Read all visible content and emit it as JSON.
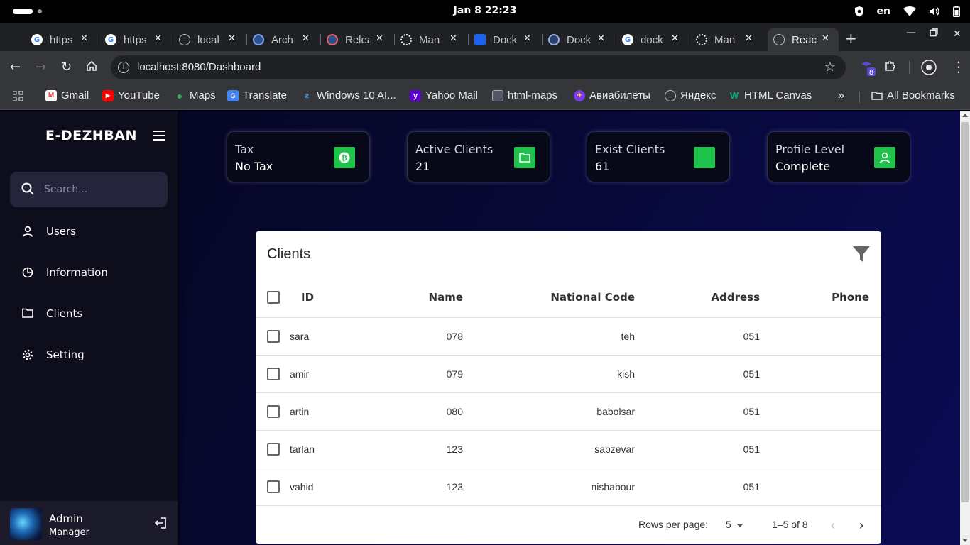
{
  "system": {
    "clock": "Jan 8  22:23",
    "language": "en"
  },
  "browser": {
    "tabs": [
      {
        "title": "https",
        "favicon": "google-icon",
        "active": false
      },
      {
        "title": "https",
        "favicon": "google-icon",
        "active": false
      },
      {
        "title": "local",
        "favicon": "globe-icon",
        "active": false
      },
      {
        "title": "Arch",
        "favicon": "docs-icon",
        "active": false
      },
      {
        "title": "Relea",
        "favicon": "docs-icon",
        "active": false
      },
      {
        "title": "Man",
        "favicon": "openai-icon",
        "active": false
      },
      {
        "title": "Dock",
        "favicon": "docker-icon",
        "active": false
      },
      {
        "title": "Dock",
        "favicon": "docs-icon",
        "active": false
      },
      {
        "title": "dock",
        "favicon": "google-icon",
        "active": false
      },
      {
        "title": "Man",
        "favicon": "openai-icon",
        "active": false
      },
      {
        "title": "Reac",
        "favicon": "globe-icon",
        "active": true
      }
    ],
    "url": "localhost:8080/Dashboard",
    "extension_badge": "8",
    "bookmarks": [
      {
        "label": "Gmail",
        "icon": "gmail-icon"
      },
      {
        "label": "YouTube",
        "icon": "youtube-icon"
      },
      {
        "label": "Maps",
        "icon": "maps-icon"
      },
      {
        "label": "Translate",
        "icon": "translate-icon"
      },
      {
        "label": "Windows 10 AI...",
        "icon": "windows-icon"
      },
      {
        "label": "Yahoo Mail",
        "icon": "yahoo-icon"
      },
      {
        "label": "html-maps",
        "icon": "image-icon"
      },
      {
        "label": "Авиабилеты",
        "icon": "plane-icon"
      },
      {
        "label": "Яндекс",
        "icon": "globe-icon"
      },
      {
        "label": "HTML Canvas",
        "icon": "w3-icon"
      }
    ],
    "all_bookmarks": "All Bookmarks"
  },
  "app": {
    "brand": "E-DEZHBAN",
    "search_placeholder": "Search...",
    "nav": [
      {
        "label": "Users",
        "icon": "user-icon"
      },
      {
        "label": "Information",
        "icon": "chart-icon"
      },
      {
        "label": "Clients",
        "icon": "folder-icon"
      },
      {
        "label": "Setting",
        "icon": "gear-icon"
      }
    ],
    "profile": {
      "name": "Admin",
      "role": "Manager"
    },
    "cards": [
      {
        "title": "Tax",
        "value": "No Tax",
        "icon": "bitcoin-icon"
      },
      {
        "title": "Active Clients",
        "value": "21",
        "icon": "folder-icon"
      },
      {
        "title": "Exist Clients",
        "value": "61",
        "icon": "blank-icon"
      },
      {
        "title": "Profile Level",
        "value": "Complete",
        "icon": "user-icon"
      }
    ],
    "accent": "#1fc24b",
    "table": {
      "title": "Clients",
      "columns": [
        "ID",
        "Name",
        "National Code",
        "Address",
        "Phone"
      ],
      "rows": [
        {
          "id": "sara",
          "name": "078",
          "national_code": "teh",
          "address": "051",
          "phone": ""
        },
        {
          "id": "amir",
          "name": "079",
          "national_code": "kish",
          "address": "051",
          "phone": ""
        },
        {
          "id": "artin",
          "name": "080",
          "national_code": "babolsar",
          "address": "051",
          "phone": ""
        },
        {
          "id": "tarlan",
          "name": "123",
          "national_code": "sabzevar",
          "address": "051",
          "phone": ""
        },
        {
          "id": "vahid",
          "name": "123",
          "national_code": "nishabour",
          "address": "051",
          "phone": ""
        }
      ],
      "rows_per_page_label": "Rows per page:",
      "rows_per_page": "5",
      "range": "1–5 of 8"
    }
  }
}
